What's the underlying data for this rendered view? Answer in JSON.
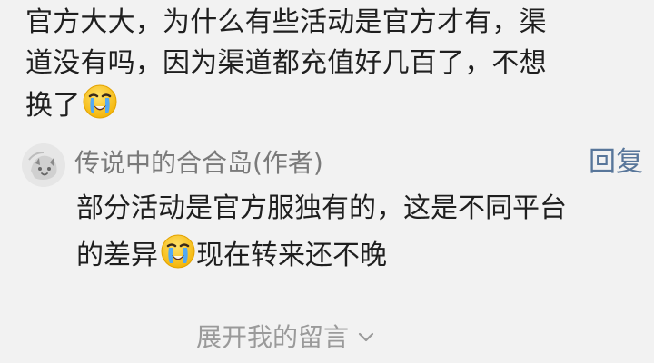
{
  "comment": {
    "lines": [
      "官方大大，为什么有些活动是官方才有，渠",
      "道没有吗，因为渠道都充值好几百了，不想",
      "换了"
    ],
    "emoji_icon": "loudly-crying-face-icon"
  },
  "reply": {
    "avatar_icon": "avatar-icon",
    "author": "传说中的合合岛(作者)",
    "reply_label": "回复",
    "lines": [
      "部分活动是官方服独有的，这是不同平台",
      "的差异",
      "现在转来还不晚"
    ],
    "emoji_icon": "loudly-crying-face-icon"
  },
  "footer": {
    "expand_label": "展开我的留言",
    "chevron_icon": "chevron-down-icon"
  }
}
